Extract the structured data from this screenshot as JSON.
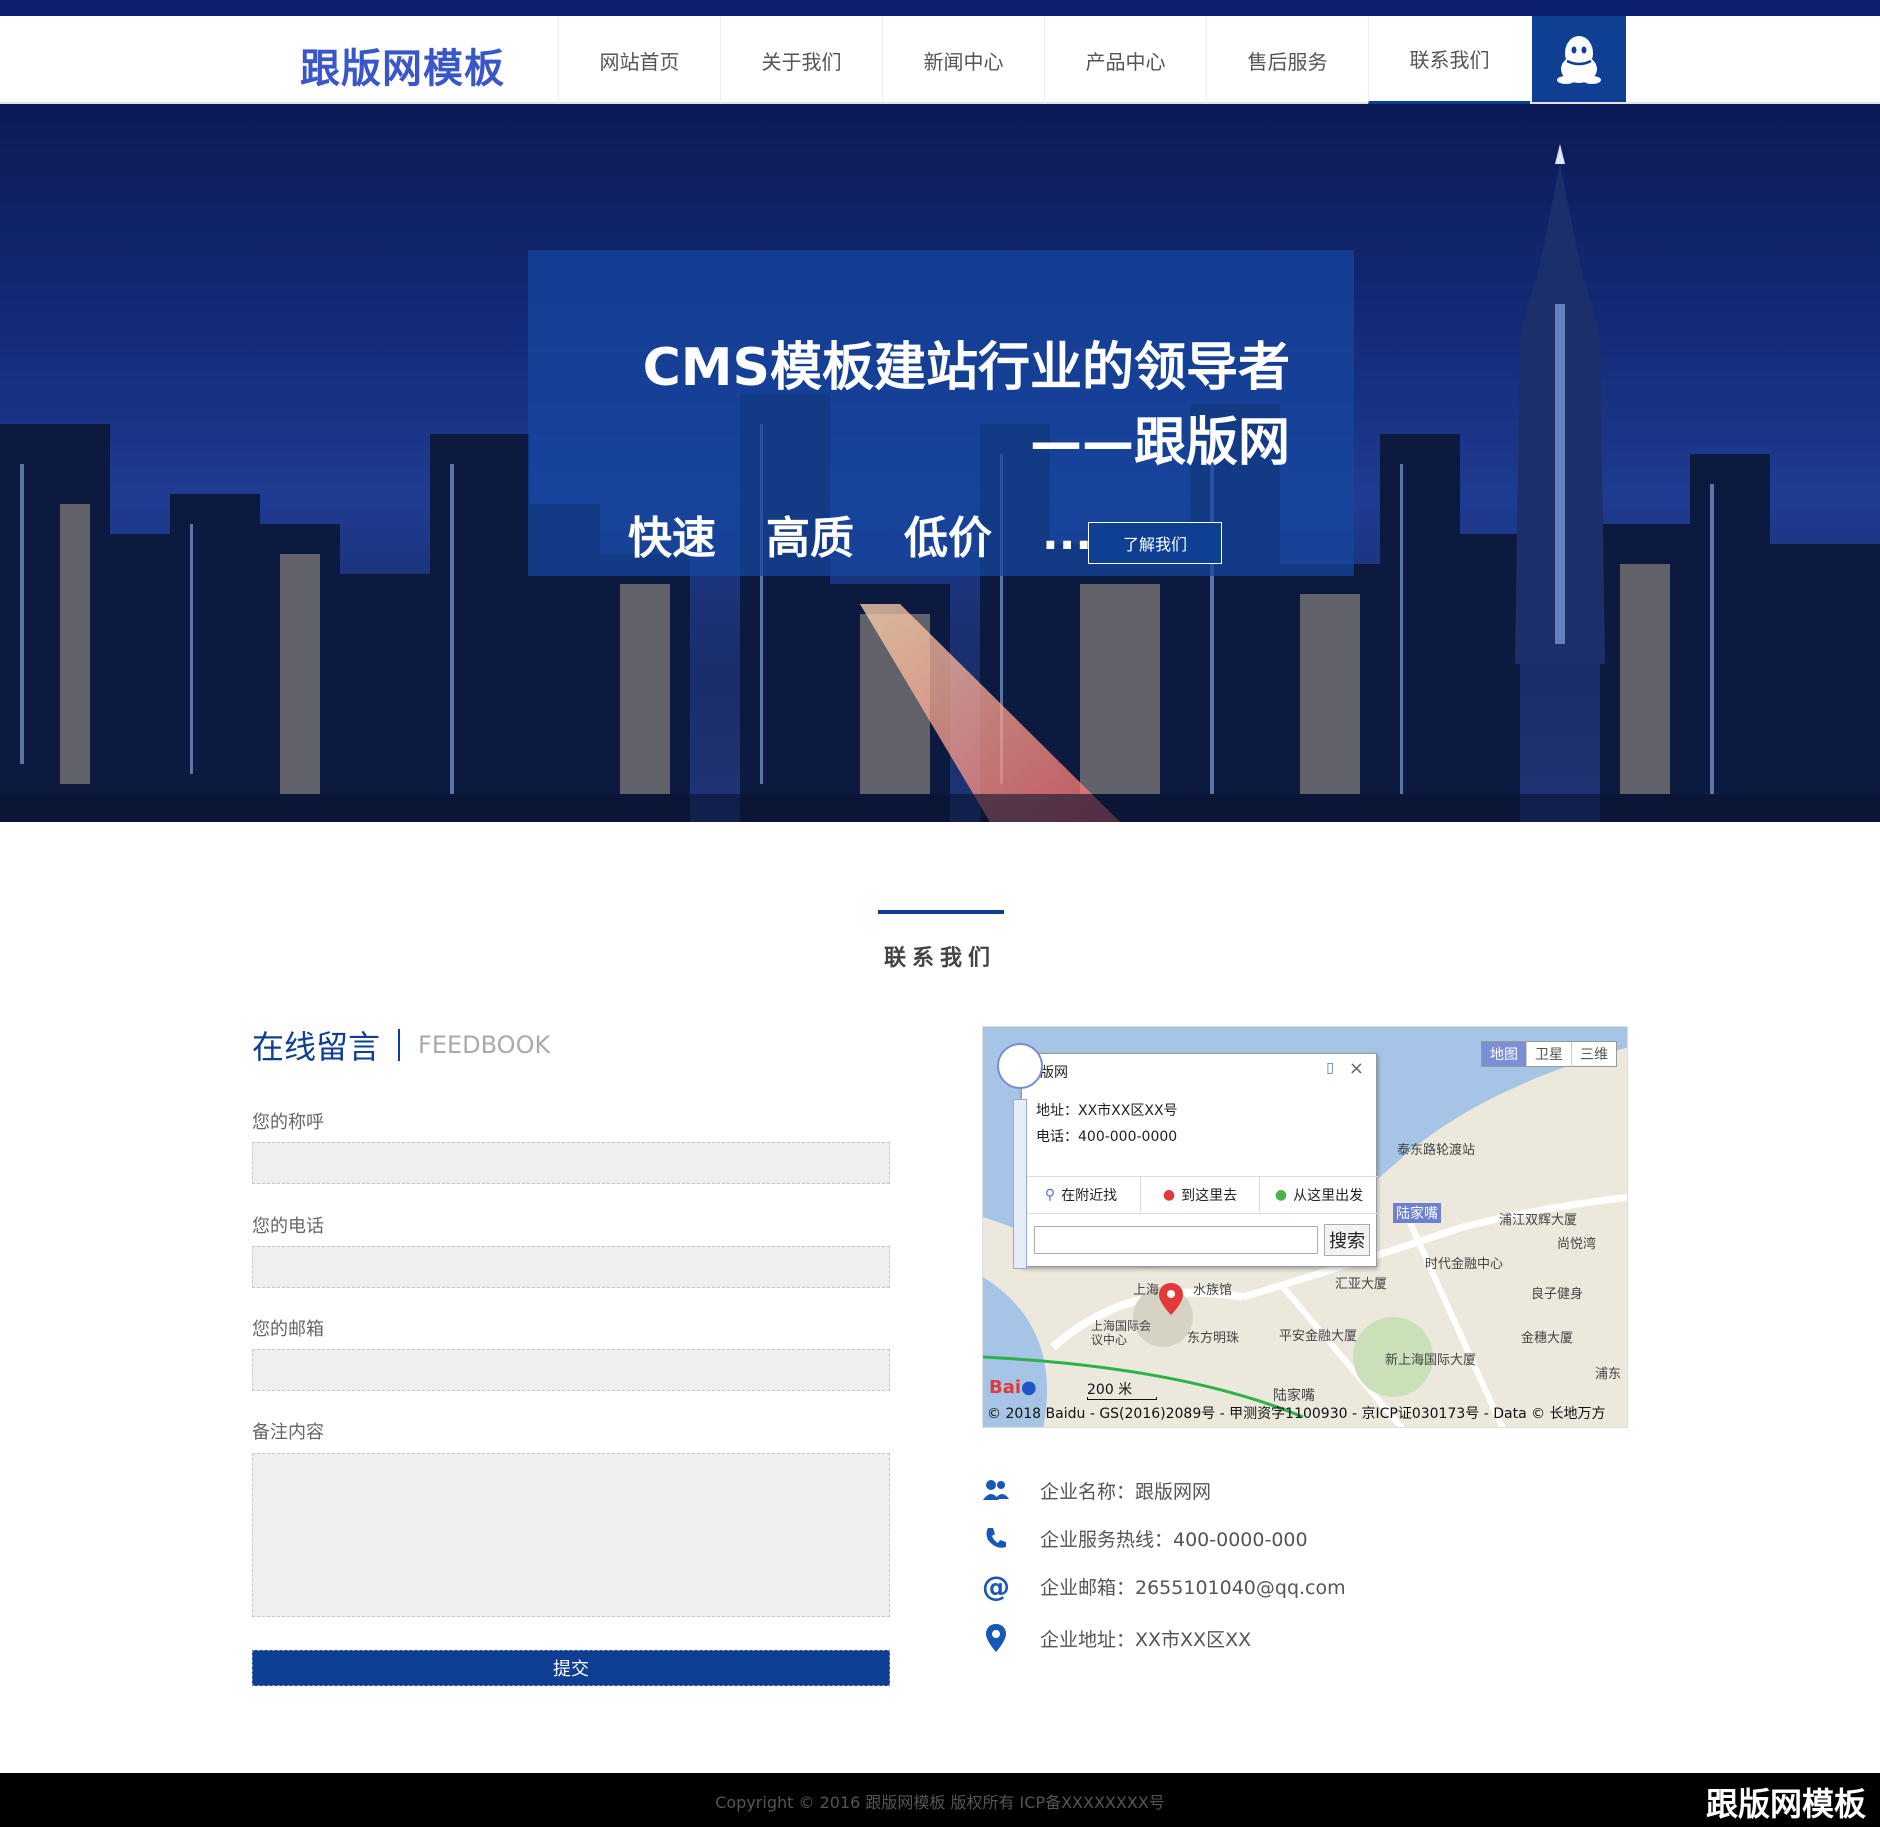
{
  "header": {
    "logo": "跟版网模板",
    "nav": [
      "网站首页",
      "关于我们",
      "新闻中心",
      "产品中心",
      "售后服务",
      "联系我们"
    ],
    "active_index": 5,
    "qq_icon": "qq-penguin-icon"
  },
  "hero": {
    "title": "CMS模板建站行业的领导者",
    "subtitle": "——跟版网",
    "keywords": [
      "快速",
      "高质",
      "低价",
      "...."
    ],
    "button": "了解我们"
  },
  "section": {
    "title": "联系我们"
  },
  "feedback": {
    "title_cn": "在线留言",
    "title_en": "FEEDBOOK",
    "fields": [
      "您的称呼",
      "您的电话",
      "您的邮箱",
      "备注内容"
    ],
    "submit": "提交"
  },
  "map": {
    "popup_title": "版网",
    "popup_address": "地址：XX市XX区XX号",
    "popup_phone": "电话：400-000-0000",
    "actions": [
      "在附近找",
      "到这里去",
      "从这里出发"
    ],
    "search_button": "搜索",
    "types": [
      "地图",
      "卫星",
      "三维"
    ],
    "scale": "200 米",
    "copyright": "© 2018 Baidu - GS(2016)2089号 - 甲测资字1100930 - 京ICP证030173号 - Data © 长地万方",
    "labels": [
      "泰东路轮渡站",
      "陆家嘴",
      "浦江双辉大厦",
      "尚悦湾",
      "时代金融中心",
      "良子健身",
      "汇亚大厦",
      "上海国际会议中心",
      "东方明珠",
      "平安金融大厦",
      "金穗大厦",
      "新上海国际大厦",
      "浦东",
      "陆家嘴",
      "水族馆",
      "上海"
    ]
  },
  "contact": [
    {
      "icon": "users-icon",
      "text": "企业名称：跟版网网"
    },
    {
      "icon": "phone-icon",
      "text": "企业服务热线：400-0000-000"
    },
    {
      "icon": "at-icon",
      "text": "企业邮箱：2655101040@qq.com"
    },
    {
      "icon": "location-pin-icon",
      "text": "企业地址：XX市XX区XX"
    }
  ],
  "footer": {
    "copyright": "Copyright © 2016 跟版网模板 版权所有 ICP备XXXXXXXX号",
    "watermark": "跟版网模板"
  },
  "colors": {
    "brand": "#0e3f93",
    "topbar": "#0c1f6e",
    "logo": "#3a57c9"
  }
}
